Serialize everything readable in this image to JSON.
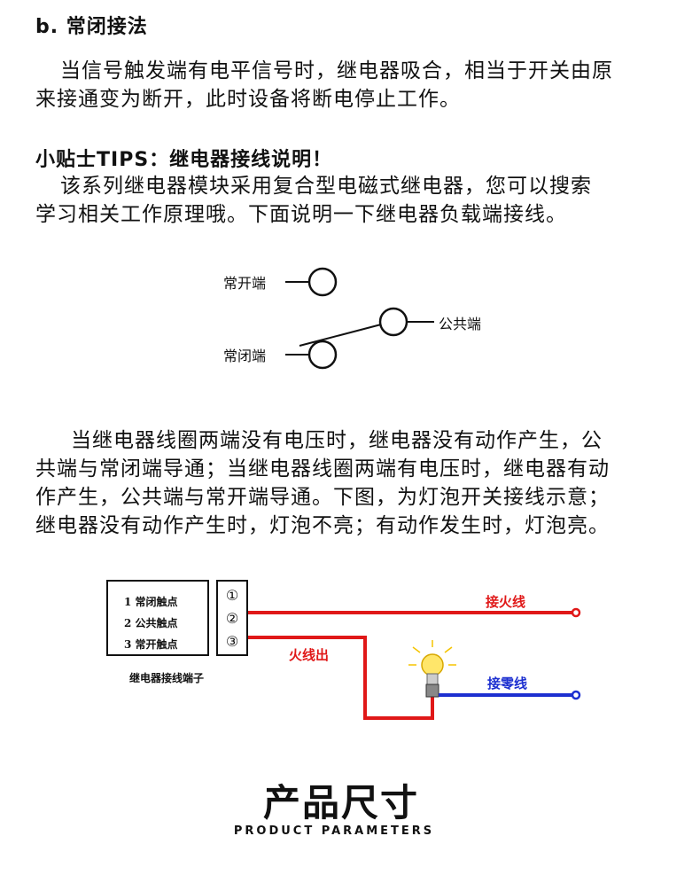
{
  "section_b": {
    "heading": "b. 常闭接法",
    "para_line1": "当信号触发端有电平信号时，继电器吸合，相当于开关由原",
    "para_line2": "来接通变为断开，此时设备将断电停止工作。"
  },
  "tips": {
    "heading": "小贴士TIPS：继电器接线说明！",
    "line1": "该系列继电器模块采用复合型电磁式继电器，您可以搜索",
    "line2": "学习相关工作原理哦。下面说明一下继电器负载端接线。"
  },
  "diagram1": {
    "no_label": "常开端",
    "nc_label": "常闭端",
    "com_label": "公共端"
  },
  "explain": {
    "line1": "当继电器线圈两端没有电压时，继电器没有动作产生，公",
    "line2": "共端与常闭端导通；当继电器线圈两端有电压时，继电器有动",
    "line3": "作产生，公共端与常开端导通。下图，为灯泡开关接线示意；",
    "line4": "继电器没有动作产生时，灯泡不亮；有动作发生时，灯泡亮。"
  },
  "diagram2": {
    "contacts": [
      "1 常闭触点",
      "2 公共触点",
      "3 常开触点"
    ],
    "numbers": [
      "①",
      "②",
      "③"
    ],
    "caption": "继电器接线端子",
    "live_in": "接火线",
    "live_out": "火线出",
    "neutral": "接零线",
    "colors": {
      "live": "#e01818",
      "neutral": "#1c2fd0"
    }
  },
  "product": {
    "title": "产品尺寸",
    "subtitle": "PRODUCT PARAMETERS"
  }
}
